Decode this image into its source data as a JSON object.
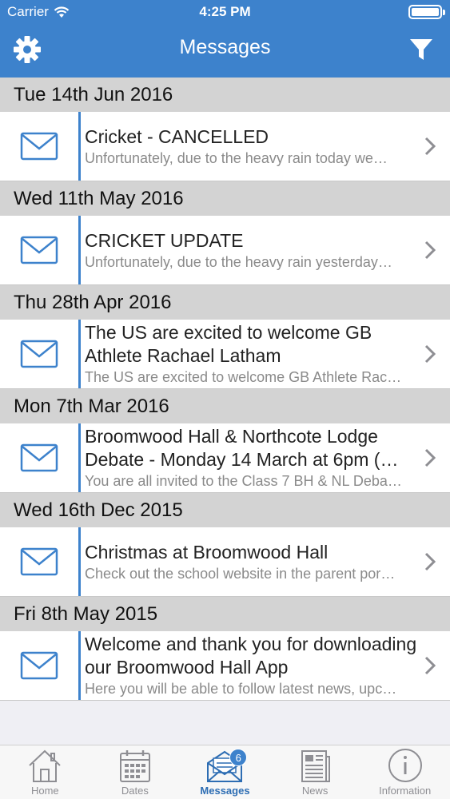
{
  "status": {
    "carrier": "Carrier",
    "time": "4:25 PM"
  },
  "navbar": {
    "title": "Messages"
  },
  "groups": [
    {
      "date": "Tue 14th Jun 2016",
      "title": "Cricket - CANCELLED",
      "preview": "Unfortunately, due to the heavy rain today we…"
    },
    {
      "date": "Wed 11th May 2016",
      "title": "CRICKET UPDATE",
      "preview": "Unfortunately, due to the heavy rain yesterday…"
    },
    {
      "date": "Thu 28th Apr 2016",
      "title": "The US are excited to welcome GB Athlete Rachael Latham",
      "preview": "The US are excited to welcome GB Athlete Rac…"
    },
    {
      "date": "Mon 7th Mar 2016",
      "title": "Broomwood Hall & Northcote Lodge Debate - Monday 14 March at 6pm (…",
      "preview": "You are all invited to the Class 7 BH & NL Deba…"
    },
    {
      "date": "Wed 16th Dec 2015",
      "title": "Christmas at Broomwood Hall",
      "preview": "Check out the school website in the parent por…"
    },
    {
      "date": "Fri 8th May 2015",
      "title": "Welcome and thank you for downloading our Broomwood Hall App",
      "preview": "Here you will be able to follow latest news, upc…"
    }
  ],
  "tabs": {
    "home": "Home",
    "dates": "Dates",
    "messages": "Messages",
    "messages_badge": "6",
    "news": "News",
    "information": "Information"
  },
  "colors": {
    "accent": "#3d82cc",
    "date_header_bg": "#d3d3d3"
  }
}
